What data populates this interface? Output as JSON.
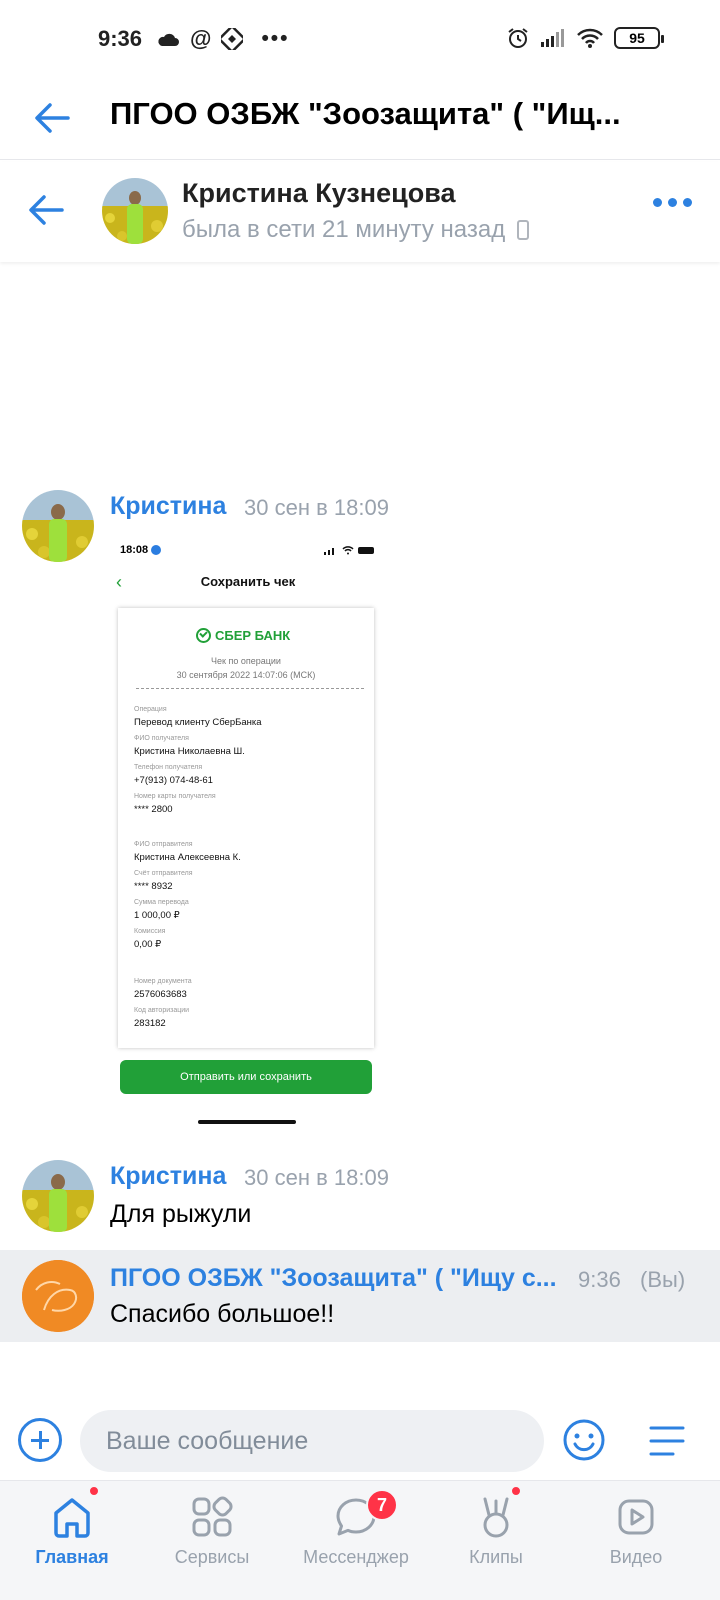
{
  "status_bar": {
    "time": "9:36",
    "icons_left": [
      "cloud-icon",
      "at-icon",
      "app-icon",
      "more-dots"
    ],
    "battery": "95"
  },
  "app_header": {
    "title": "ПГОО ОЗБЖ \"Зоозащита\" ( \"Ищ..."
  },
  "chat_header": {
    "name": "Кристина Кузнецова",
    "status": "была в сети 21 минуту назад"
  },
  "messages": [
    {
      "author": "Кристина",
      "time": "30 сен в 18:09",
      "attachment": {
        "status_time": "18:08",
        "screen_title": "Сохранить чек",
        "bank_name": "СБЕР БАНК",
        "receipt_header": "Чек по операции",
        "receipt_datetime": "30 сентября 2022 14:07:06 (МСК)",
        "fields": [
          {
            "label": "Операция",
            "value": "Перевод клиенту СберБанка"
          },
          {
            "label": "ФИО получателя",
            "value": "Кристина Николаевна Ш."
          },
          {
            "label": "Телефон получателя",
            "value": "+7(913) 074-48-61"
          },
          {
            "label": "Номер карты получателя",
            "value": "**** 2800"
          },
          {
            "label": "ФИО отправителя",
            "value": "Кристина Алексеевна К."
          },
          {
            "label": "Счёт отправителя",
            "value": "**** 8932"
          },
          {
            "label": "Сумма перевода",
            "value": "1 000,00 ₽"
          },
          {
            "label": "Комиссия",
            "value": "0,00 ₽"
          },
          {
            "label": "Номер документа",
            "value": "2576063683"
          },
          {
            "label": "Код авторизации",
            "value": "283182"
          }
        ],
        "button": "Отправить или сохранить"
      }
    },
    {
      "author": "Кристина",
      "time": "30 сен в 18:09",
      "text": "Для рыжули"
    },
    {
      "author": "ПГОО ОЗБЖ \"Зоозащита\" ( \"Ищу с...",
      "time": "9:36",
      "suffix": "(Вы)",
      "text": "Спасибо большое!!"
    }
  ],
  "composer": {
    "placeholder": "Ваше сообщение"
  },
  "bottom_nav": [
    {
      "label": "Главная",
      "icon": "home-icon",
      "active": true,
      "dot": true
    },
    {
      "label": "Сервисы",
      "icon": "services-icon",
      "active": false
    },
    {
      "label": "Мессенджер",
      "icon": "messenger-icon",
      "active": false,
      "badge": "7"
    },
    {
      "label": "Клипы",
      "icon": "clips-icon",
      "active": false,
      "dot": true
    },
    {
      "label": "Видео",
      "icon": "video-icon",
      "active": false
    }
  ],
  "colors": {
    "accent": "#2d81e0",
    "badge": "#ff3347",
    "sber_green": "#21a038",
    "own_message_bg": "#eceef1"
  }
}
